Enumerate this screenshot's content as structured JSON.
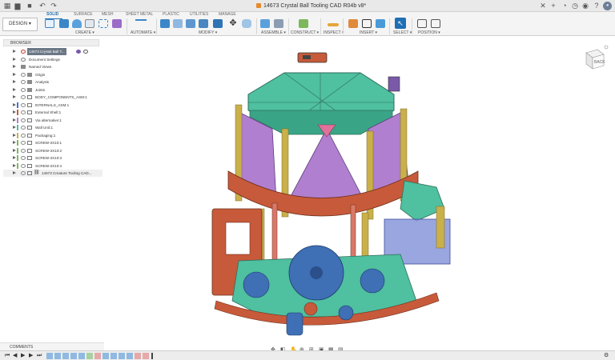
{
  "titlebar": {
    "doc_title": "14673 Crystal Ball Tooling CAD R04b v8*",
    "icons": [
      "grid-icon",
      "file-icon",
      "save-icon",
      "undo-icon",
      "redo-icon",
      "close-tab-icon",
      "add-tab-icon",
      "extensions-icon",
      "job-status-icon",
      "notifications-icon",
      "help-icon",
      "account-icon"
    ]
  },
  "toolbar": {
    "design_label": "DESIGN ▾",
    "tabs": [
      "SOLID",
      "SURFACE",
      "MESH",
      "SHEET METAL",
      "PLASTIC",
      "UTILITIES",
      "MANAGE"
    ],
    "groups": [
      "CREATE ▾",
      "AUTOMATE ▾",
      "MODIFY ▾",
      "ASSEMBLE ▾",
      "CONSTRUCT ▾",
      "INSPECT ▾",
      "INSERT ▾",
      "SELECT ▾",
      "POSITION ▾"
    ]
  },
  "browser": {
    "header": "BROWSER",
    "items": [
      {
        "label": "14673 Crystal Ball T...",
        "type": "root"
      },
      {
        "label": "Document Settings",
        "type": "settings"
      },
      {
        "label": "Named Views",
        "type": "folder"
      },
      {
        "label": "Origin",
        "type": "folder"
      },
      {
        "label": "Analysis",
        "type": "folder"
      },
      {
        "label": "Joints",
        "type": "folder"
      },
      {
        "label": "BODY_COMPONENTS_ASM:1",
        "type": "component"
      },
      {
        "label": "INTERNALS_ASM:1",
        "type": "component"
      },
      {
        "label": "External Shell:1",
        "type": "component"
      },
      {
        "label": "Via alternative:1",
        "type": "component"
      },
      {
        "label": "Wall Unit:1",
        "type": "component"
      },
      {
        "label": "Packaging:1",
        "type": "component"
      },
      {
        "label": "SCREW-3X10:1",
        "type": "component"
      },
      {
        "label": "SCREW-3X10:2",
        "type": "component"
      },
      {
        "label": "SCREW-3X10:3",
        "type": "component"
      },
      {
        "label": "SCREW-3X10:4",
        "type": "component"
      },
      {
        "label": "14673 Creature Tooling CAD...",
        "type": "linked"
      }
    ]
  },
  "comments": {
    "label": "COMMENTS"
  },
  "viewcube": {
    "face_label": "BACK"
  },
  "colors": {
    "accent": "#1f6fb3",
    "teal": "#4fc0a0",
    "rust": "#c75a3a",
    "purple": "#b07fcf",
    "gear_blue": "#3f6fb4",
    "spring_gold": "#c9b04a"
  }
}
